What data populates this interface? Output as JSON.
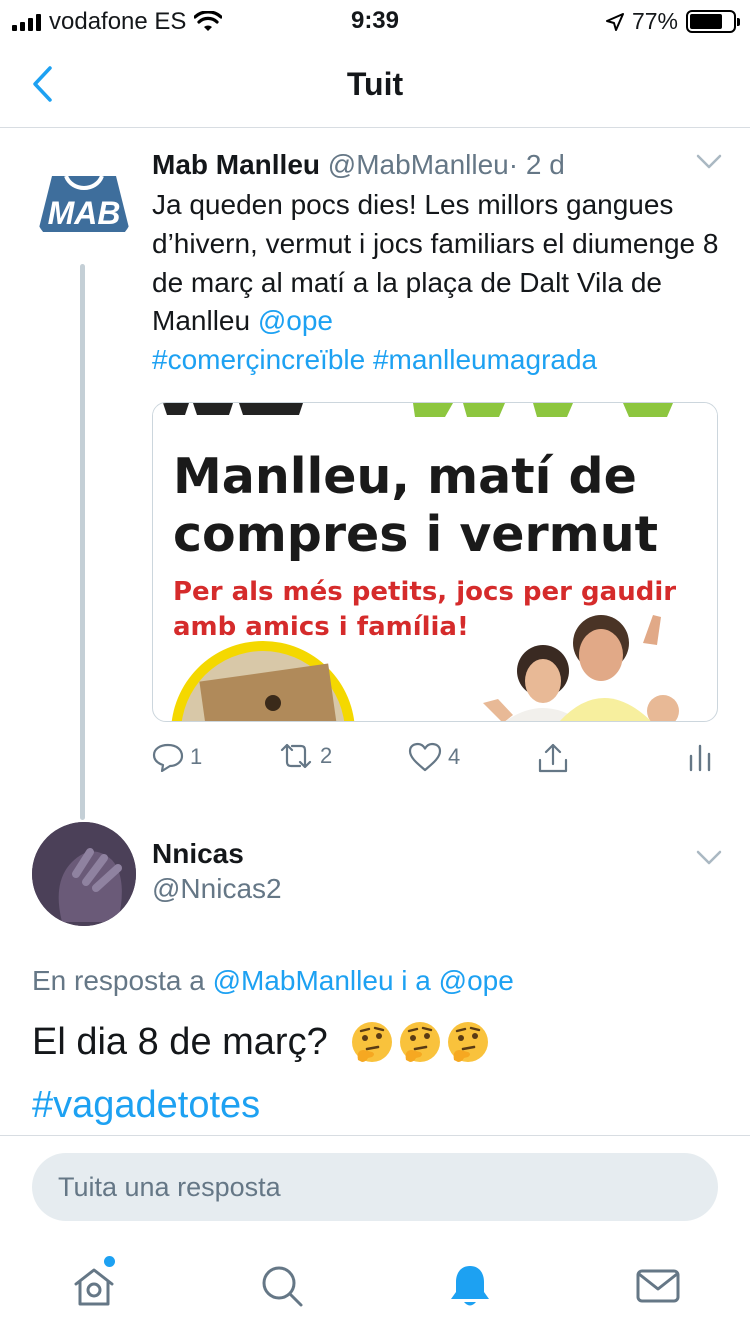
{
  "status_bar": {
    "carrier": "vodafone ES",
    "time": "9:39",
    "battery": "77%",
    "battery_level": 0.77
  },
  "nav": {
    "title": "Tuit"
  },
  "tweet": {
    "name": "Mab Manlleu",
    "handle": "@MabManlleu",
    "separator": "·",
    "time": "2 d",
    "text_main": "Ja queden pocs dies! Les millors gangues d’hivern, vermut i jocs familiars el diumenge 8 de març al matí a la plaça de Dalt Vila de Manlleu ",
    "mention": "@ope",
    "hashtags": "#comerçincreïble #manlleumagrada",
    "avatar_text": "MAB",
    "media": {
      "headline_1": "Manlleu, matí de",
      "headline_2": "compres i vermut",
      "sub_1": "Per als més petits,  jocs per gaudir",
      "sub_2": "amb amics i família!"
    },
    "actions": {
      "replies": "1",
      "retweets": "2",
      "likes": "4"
    }
  },
  "reply": {
    "name": "Nnicas",
    "handle": "@Nnicas2",
    "in_reply_prefix": "En resposta a ",
    "in_reply_users": "@MabManlleu i a @ope",
    "text": "El dia 8 de març?",
    "emojis": [
      "🤔",
      "🤔",
      "🤔"
    ],
    "hashtag": "#vagadetotes"
  },
  "compose": {
    "placeholder": "Tuita una resposta"
  },
  "tab_bar": {
    "icons": [
      "home-icon",
      "search-icon",
      "notifications-icon",
      "messages-icon"
    ]
  },
  "colors": {
    "accent": "#1da1f2",
    "text": "#14171a",
    "secondary": "#657786"
  }
}
